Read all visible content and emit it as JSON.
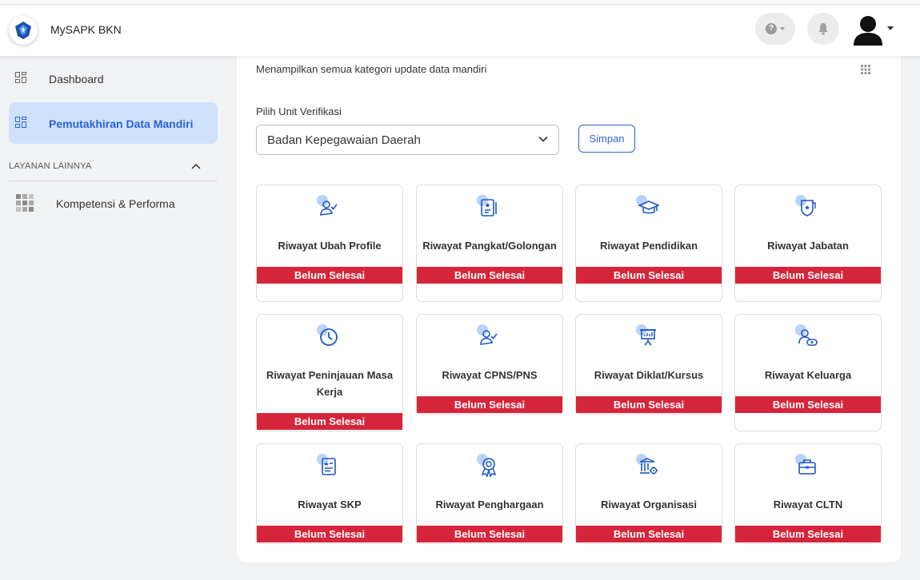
{
  "header": {
    "app_title": "MySAPK BKN",
    "help_icon_glyph": "?"
  },
  "sidebar": {
    "items": [
      {
        "label": "Dashboard",
        "icon": "grid-layout-icon"
      },
      {
        "label": "Pemutakhiran Data Mandiri",
        "icon": "grid-layout-icon",
        "active": true
      }
    ],
    "section_label": "LAYANAN LAINNYA",
    "other_items": [
      {
        "label": "Kompetensi & Performa",
        "icon": "apps-grid-icon"
      }
    ]
  },
  "main": {
    "description": "Menampilkan semua kategori update data mandiri",
    "unit_label": "Pilih Unit Verifikasi",
    "unit_value": "Badan Kepegawaian Daerah",
    "save_label": "Simpan",
    "status_color": "#d6253a",
    "accent_color": "#2a62d6",
    "tiles": [
      {
        "title": "Riwayat Ubah Profile",
        "status": "Belum Selesai",
        "icon": "user-check-icon"
      },
      {
        "title": "Riwayat Pangkat/Golongan",
        "status": "Belum Selesai",
        "icon": "id-card-icon"
      },
      {
        "title": "Riwayat Pendidikan",
        "status": "Belum Selesai",
        "icon": "graduation-cap-icon"
      },
      {
        "title": "Riwayat Jabatan",
        "status": "Belum Selesai",
        "icon": "shield-badge-icon"
      },
      {
        "title": "Riwayat Peninjauan Masa Kerja",
        "status": "Belum Selesai",
        "icon": "clock-icon"
      },
      {
        "title": "Riwayat CPNS/PNS",
        "status": "Belum Selesai",
        "icon": "user-check-icon"
      },
      {
        "title": "Riwayat Diklat/Kursus",
        "status": "Belum Selesai",
        "icon": "presentation-icon"
      },
      {
        "title": "Riwayat Keluarga",
        "status": "Belum Selesai",
        "icon": "family-icon"
      },
      {
        "title": "Riwayat SKP",
        "status": "Belum Selesai",
        "icon": "document-star-icon"
      },
      {
        "title": "Riwayat Penghargaan",
        "status": "Belum Selesai",
        "icon": "award-icon"
      },
      {
        "title": "Riwayat Organisasi",
        "status": "Belum Selesai",
        "icon": "building-gear-icon"
      },
      {
        "title": "Riwayat CLTN",
        "status": "Belum Selesai",
        "icon": "briefcase-icon"
      }
    ]
  }
}
